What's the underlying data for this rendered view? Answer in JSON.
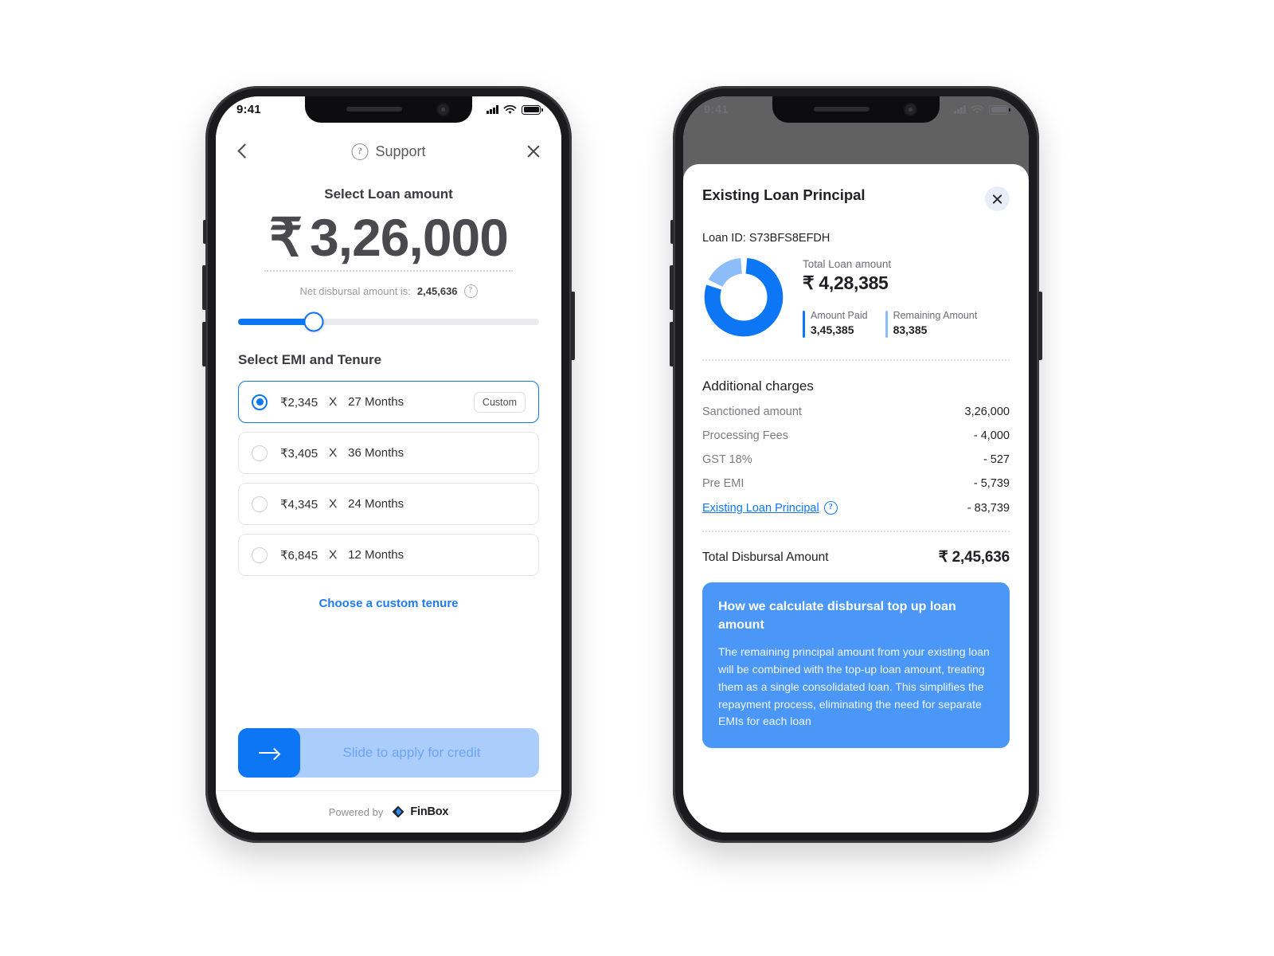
{
  "phone1": {
    "status": {
      "time": "9:41"
    },
    "nav": {
      "support_label": "Support",
      "back_icon": "chevron-left-icon",
      "close_icon": "close-icon",
      "help_icon": "question-circle-icon"
    },
    "amount": {
      "title": "Select Loan amount",
      "rupee": "₹",
      "value": "3,26,000",
      "net_prefix": "Net disbursal amount is:",
      "net_value": "2,45,636"
    },
    "slider": {
      "fill_percent": 25
    },
    "emi": {
      "title": "Select EMI and Tenure",
      "options": [
        {
          "emi": "₹2,345",
          "x": "X",
          "tenure": "27 Months",
          "badge": "Custom",
          "selected": true
        },
        {
          "emi": "₹3,405",
          "x": "X",
          "tenure": "36 Months",
          "badge": "",
          "selected": false
        },
        {
          "emi": "₹4,345",
          "x": "X",
          "tenure": "24 Months",
          "badge": "",
          "selected": false
        },
        {
          "emi": "₹6,845",
          "x": "X",
          "tenure": "12 Months",
          "badge": "",
          "selected": false
        }
      ],
      "custom_link": "Choose a custom tenure"
    },
    "cta": {
      "label": "Slide to apply for credit",
      "arrow_icon": "arrow-right-icon"
    },
    "footer": {
      "powered_by": "Powered by",
      "brand": "FinBox"
    }
  },
  "phone2": {
    "status": {
      "time": "9:41"
    },
    "sheet": {
      "title": "Existing Loan Principal",
      "close_icon": "close-icon",
      "loan_id": "Loan ID: S73BFS8EFDH",
      "summary": {
        "total_label": "Total Loan amount",
        "total_value": "₹ 4,28,385",
        "paid_label": "Amount Paid",
        "paid_value": "3,45,385",
        "remaining_label": "Remaining Amount",
        "remaining_value": "83,385"
      },
      "charges_title": "Additional charges",
      "charges": [
        {
          "label": "Sanctioned  amount",
          "value": "3,26,000",
          "link": false
        },
        {
          "label": "Processing Fees",
          "value": "- 4,000",
          "link": false
        },
        {
          "label": "GST 18%",
          "value": "- 527",
          "link": false
        },
        {
          "label": "Pre EMI",
          "value": "- 5,739",
          "link": false
        },
        {
          "label": "Existing Loan Principal",
          "value": "- 83,739",
          "link": true
        }
      ],
      "total": {
        "label": "Total Disbursal Amount",
        "value": "₹ 2,45,636"
      },
      "info_card": {
        "title": "How we calculate disbursal top up loan amount",
        "body": "The remaining principal amount from your existing loan will be combined with the top-up loan amount, treating them as a single consolidated loan. This simplifies the repayment process, eliminating the need for separate EMIs for each loan"
      }
    }
  },
  "chart_data": {
    "type": "pie",
    "title": "Total Loan amount",
    "categories": [
      "Amount Paid",
      "Remaining Amount"
    ],
    "values": [
      345385,
      83385
    ],
    "total": 428385,
    "colors": [
      "#0d76f5",
      "#8dbdf8"
    ],
    "legend": "right",
    "donut": true
  },
  "colors": {
    "accent": "#0d76f5",
    "accent_light": "#8dbdf8",
    "info_card": "#4a97f7",
    "text_dark": "#1f1f24",
    "text_muted": "#7b7b82"
  }
}
